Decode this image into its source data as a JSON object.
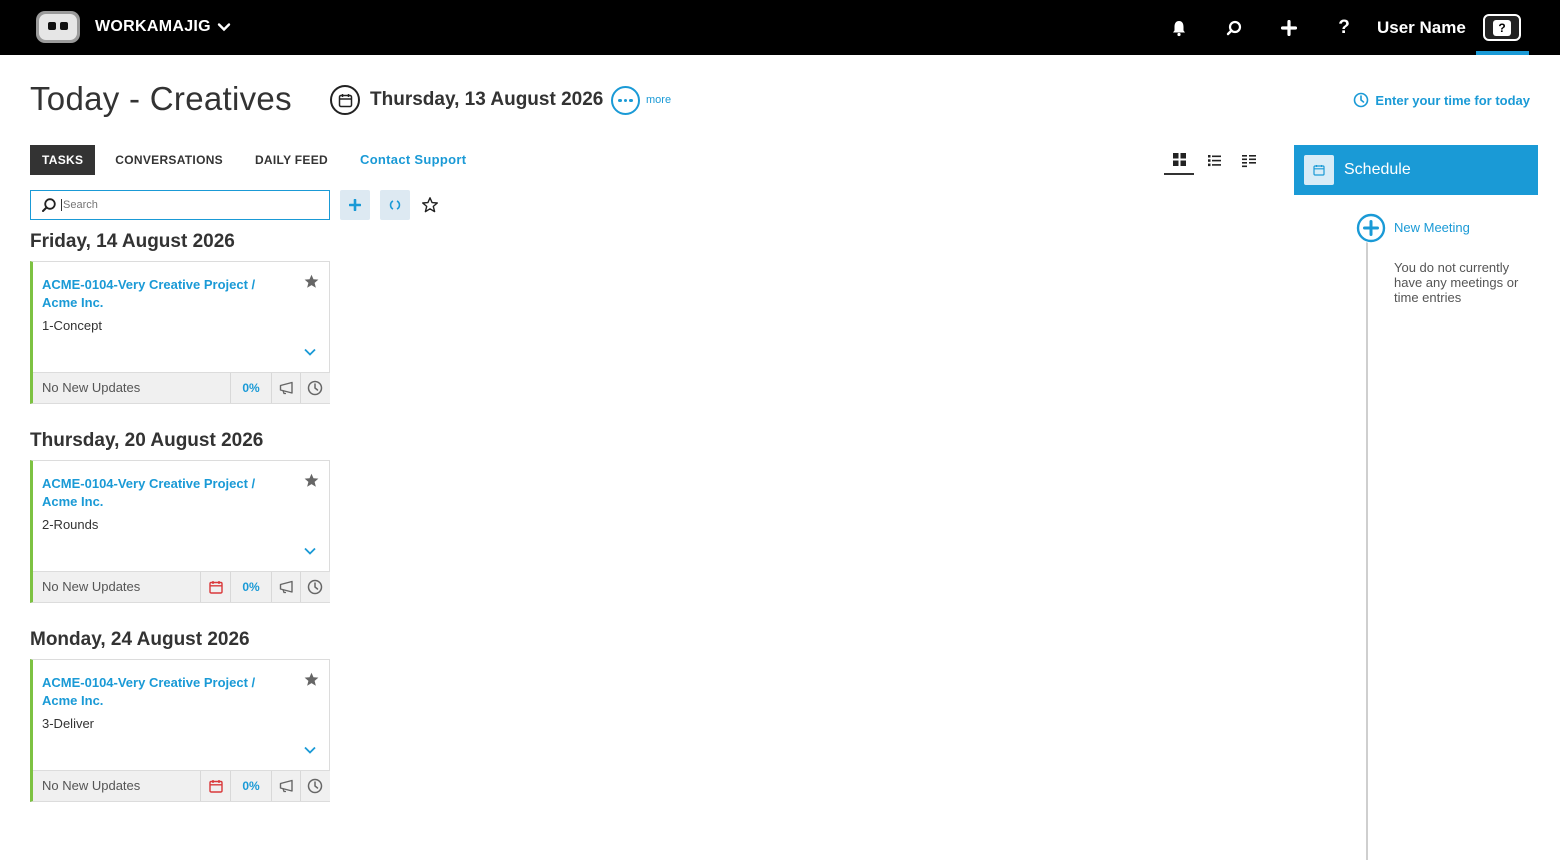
{
  "app": {
    "brand": "WORKAMAJIG",
    "user_name": "User Name",
    "help_glyph": "?"
  },
  "header": {
    "title": "Today - Creatives",
    "date": "Thursday, 13 August 2026",
    "more_label": "more",
    "enter_time": "Enter your time for today"
  },
  "tabs": [
    {
      "label": "TASKS",
      "active": true
    },
    {
      "label": "CONVERSATIONS",
      "active": false
    },
    {
      "label": "DAILY FEED",
      "active": false
    },
    {
      "label": "Contact Support",
      "active": false
    }
  ],
  "search": {
    "placeholder": "Search"
  },
  "sections": [
    {
      "date": "Friday, 14 August 2026",
      "project": "ACME-0104-Very Creative Project / Acme Inc.",
      "task": "1-Concept",
      "status": "No New Updates",
      "percent": "0%",
      "has_due_icon": false
    },
    {
      "date": "Thursday, 20 August 2026",
      "project": "ACME-0104-Very Creative Project / Acme Inc.",
      "task": "2-Rounds",
      "status": "No New Updates",
      "percent": "0%",
      "has_due_icon": true
    },
    {
      "date": "Monday, 24 August 2026",
      "project": "ACME-0104-Very Creative Project / Acme Inc.",
      "task": "3-Deliver",
      "status": "No New Updates",
      "percent": "0%",
      "has_due_icon": true
    }
  ],
  "schedule": {
    "title": "Schedule",
    "new_meeting": "New Meeting",
    "empty_text": "You do not currently have any meetings or time entries"
  },
  "colors": {
    "accent": "#1a9ad6",
    "topbar": "#000000",
    "task_border": "#7dc242",
    "due": "#d9383a"
  }
}
